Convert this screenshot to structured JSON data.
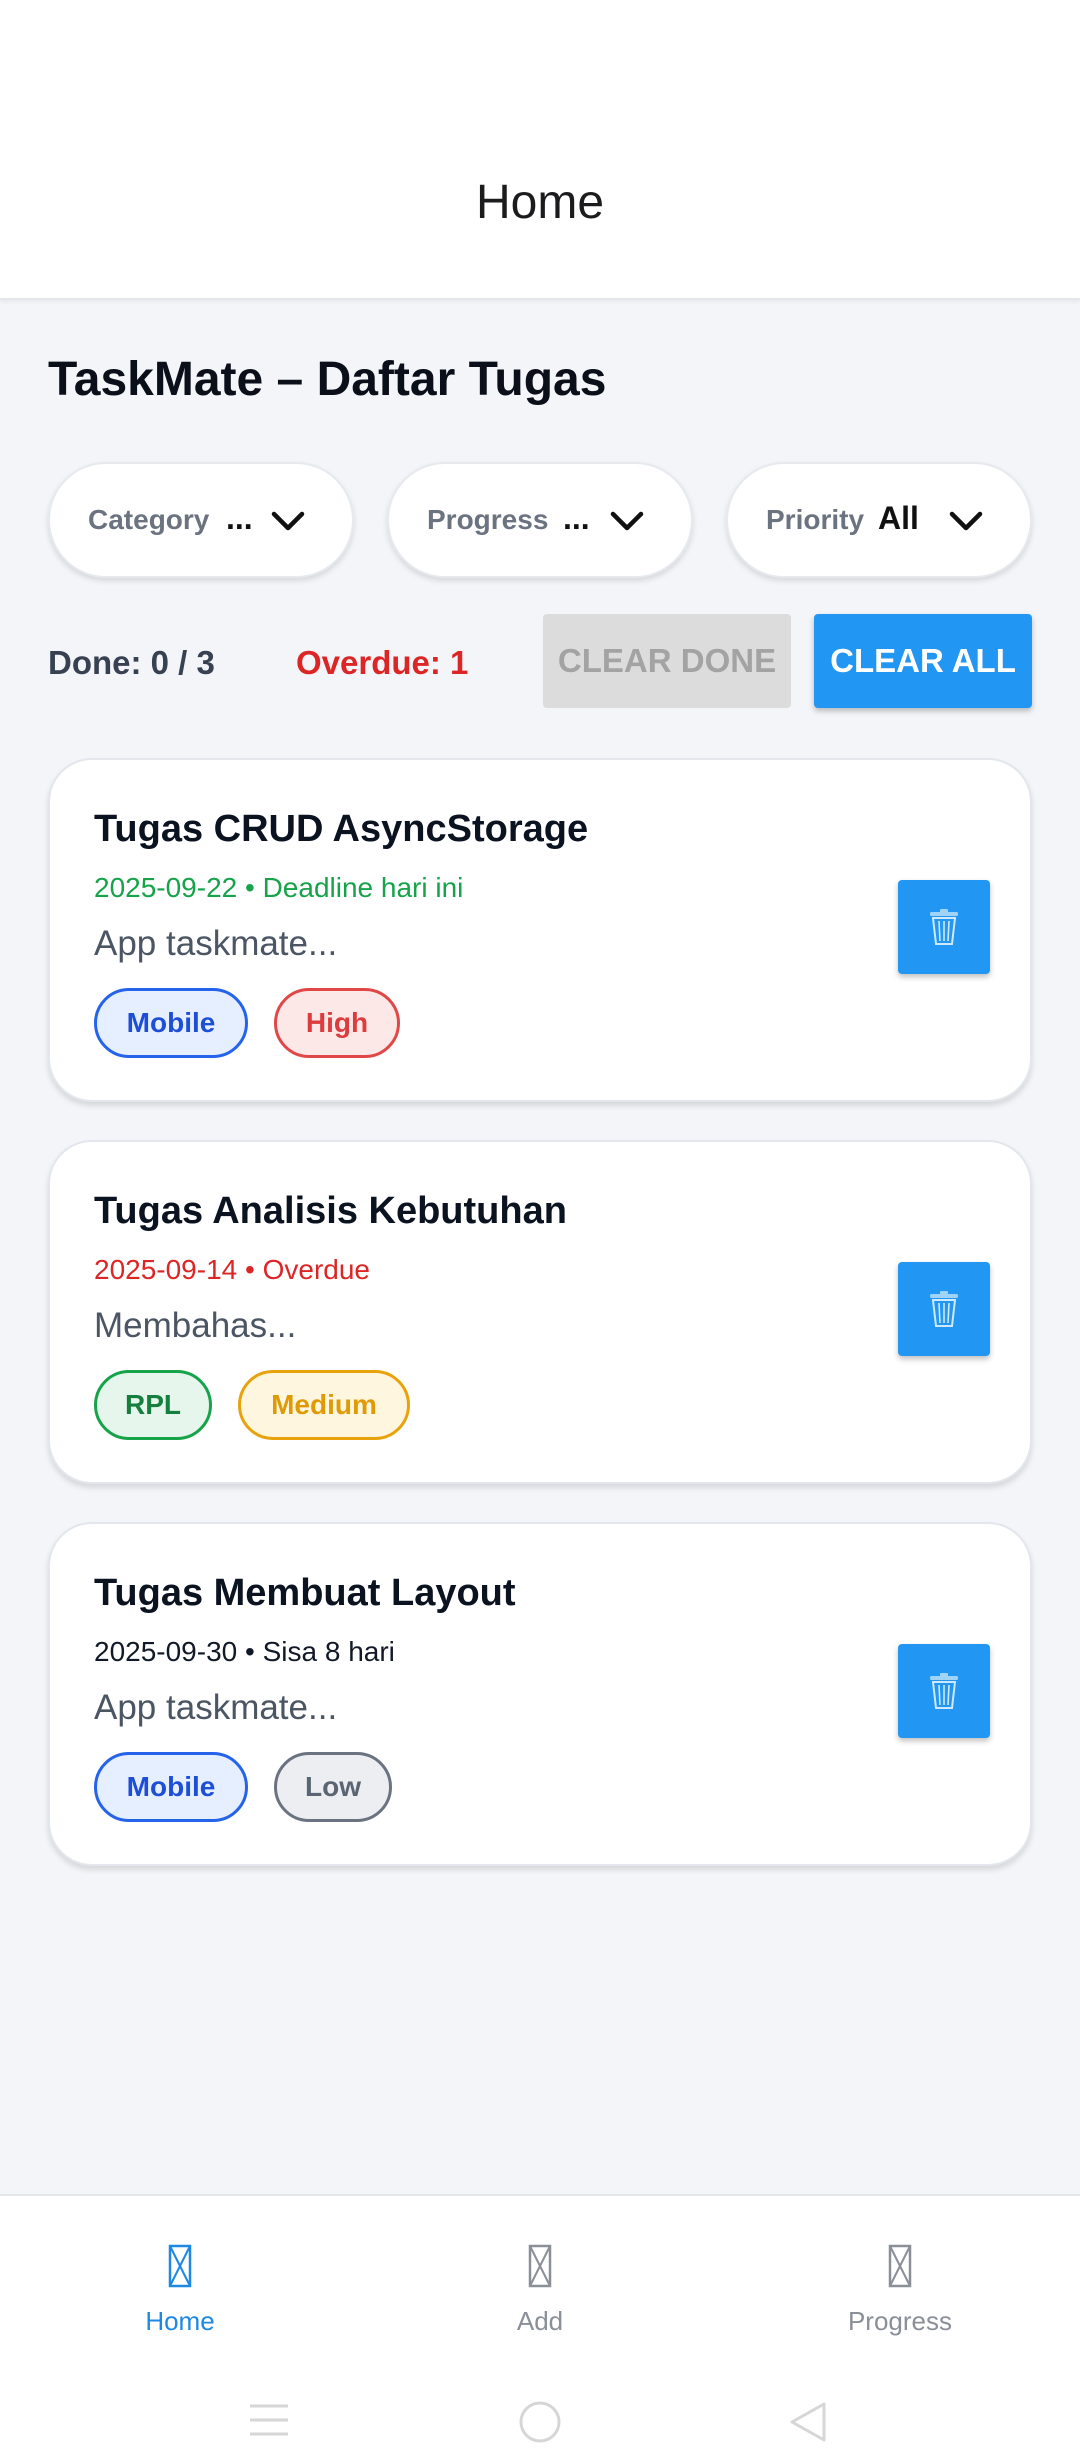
{
  "appbar": {
    "title": "Home"
  },
  "page": {
    "title": "TaskMate – Daftar Tugas"
  },
  "filters": [
    {
      "label": "Category",
      "value": "..."
    },
    {
      "label": "Progress",
      "value": "..."
    },
    {
      "label": "Priority",
      "value": "All"
    }
  ],
  "stats": {
    "done": "Done: 0 / 3",
    "overdue": "Overdue: 1",
    "clear_done": "CLEAR DONE",
    "clear_all": "CLEAR ALL"
  },
  "tasks": [
    {
      "title": "Tugas CRUD AsyncStorage",
      "date_line": "2025-09-22 • Deadline hari ini",
      "date_color": "#16a34a",
      "desc": "App taskmate...",
      "category": "Mobile",
      "priority": "High"
    },
    {
      "title": "Tugas Analisis Kebutuhan",
      "date_line": "2025-09-14 • Overdue",
      "date_color": "#dc2626",
      "desc": "Membahas...",
      "category": "RPL",
      "priority": "Medium"
    },
    {
      "title": "Tugas Membuat Layout",
      "date_line": "2025-09-30 • Sisa 8 hari",
      "date_color": "#111827",
      "desc": "App taskmate...",
      "category": "Mobile",
      "priority": "Low"
    }
  ],
  "nav": [
    {
      "label": "Home",
      "icon": "home-icon",
      "active": true
    },
    {
      "label": "Add",
      "icon": "add-icon",
      "active": false
    },
    {
      "label": "Progress",
      "icon": "progress-icon",
      "active": false
    }
  ],
  "colors": {
    "accent": "#2196f3",
    "nav_active": "#1e88e5",
    "nav_inactive": "#8a8f98",
    "overdue": "#dc2626"
  }
}
